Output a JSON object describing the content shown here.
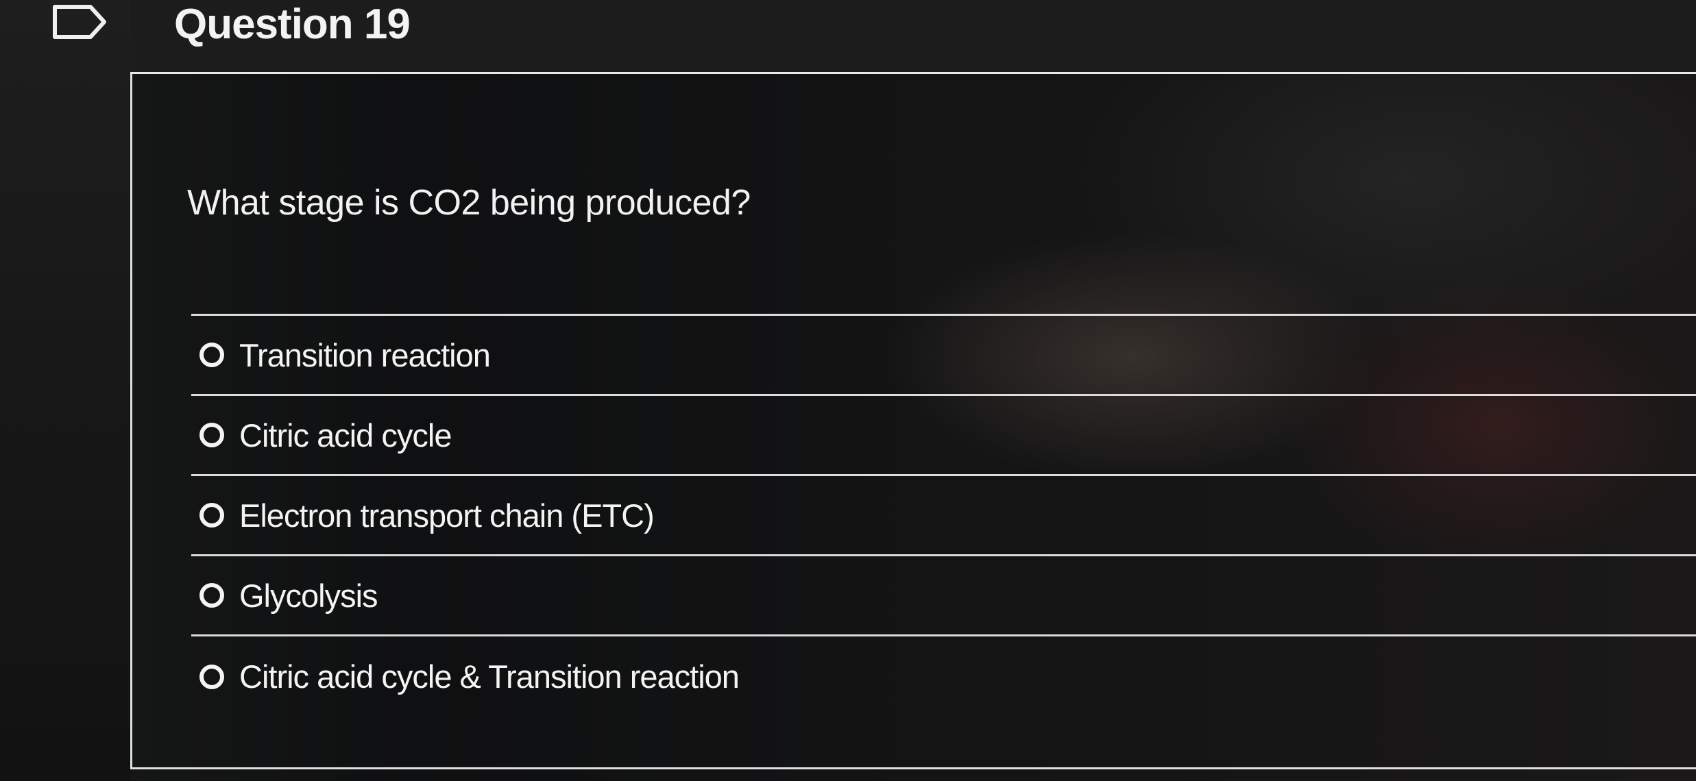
{
  "question": {
    "title": "Question 19",
    "prompt": "What stage is CO2 being produced?",
    "choices": [
      {
        "label": "Transition reaction"
      },
      {
        "label": "Citric acid cycle"
      },
      {
        "label": "Electron transport chain (ETC)"
      },
      {
        "label": "Glycolysis"
      },
      {
        "label": "Citric acid cycle & Transition reaction"
      }
    ]
  },
  "icons": {
    "flag": "flag-icon"
  },
  "colors": {
    "text": "#f4f4f4",
    "divider": "#dcdcdc",
    "background": "#111212"
  }
}
